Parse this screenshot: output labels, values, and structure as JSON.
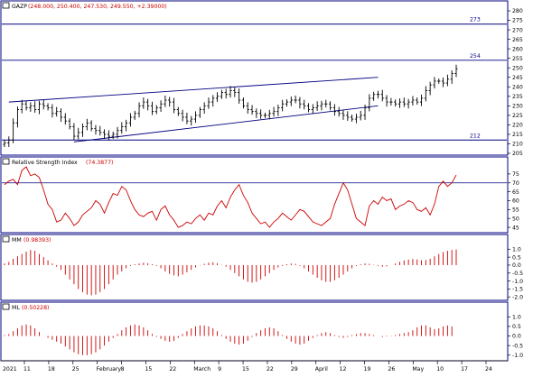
{
  "panels": {
    "price": {
      "ticker": "GAZP",
      "ohlc_readout": "(248.000, 250.400, 247.530, 249.550, +2.39000)",
      "levels": [
        {
          "value": 273,
          "label": "273"
        },
        {
          "value": 254,
          "label": "254"
        },
        {
          "value": 212,
          "label": "212"
        }
      ]
    },
    "rsi": {
      "name": "Relative Strength Index",
      "readout": "(74.3877)",
      "level": 70
    },
    "mm": {
      "name": "MM",
      "readout": "(0.98393)"
    },
    "ml": {
      "name": "ML",
      "readout": "(0.50228)"
    }
  },
  "x_axis": {
    "labels": [
      "11",
      "18",
      "25",
      "February",
      "8",
      "15",
      "22",
      "March",
      "9",
      "15",
      "22",
      "29",
      "April",
      "12",
      "19",
      "26",
      "May",
      "10",
      "17",
      "24"
    ],
    "year_label": "2021"
  },
  "colors": {
    "frame": "#000080",
    "price_level": "#000080",
    "rsi_line": "#cc0000",
    "hist": "#cc0000",
    "bar": "#000000",
    "text_accent": "#cc0000"
  },
  "chart_data": [
    {
      "type": "ohlc",
      "title": "GAZP",
      "ylim": [
        205,
        280
      ],
      "yticks": [
        205,
        210,
        215,
        220,
        225,
        230,
        235,
        240,
        245,
        250,
        255,
        260,
        265,
        270,
        275,
        280
      ],
      "channel": [
        {
          "from": [
            1,
            232
          ],
          "to": [
            86,
            245
          ]
        },
        {
          "from": [
            16,
            211
          ],
          "to": [
            86,
            230
          ]
        }
      ],
      "close": [
        210.5,
        212,
        221,
        228,
        231,
        229,
        230,
        228,
        231,
        230,
        229,
        226,
        227,
        224,
        222,
        219,
        214,
        216,
        219,
        221,
        218,
        217,
        216,
        215,
        214,
        215,
        217,
        219,
        221,
        224,
        226,
        230,
        232,
        230,
        227,
        229,
        231,
        233,
        232,
        228,
        226,
        224,
        222,
        223,
        225,
        228,
        230,
        232,
        234,
        235,
        237,
        236,
        238,
        237,
        233,
        230,
        228,
        227,
        226,
        225,
        225,
        226,
        227,
        229,
        231,
        232,
        233,
        233,
        231,
        230,
        228,
        229,
        230,
        231,
        231,
        229,
        227,
        226,
        225,
        224,
        223,
        224,
        225,
        229,
        234,
        236,
        236,
        234,
        232,
        232,
        231,
        232,
        231,
        232,
        233,
        232,
        234,
        238,
        241,
        243,
        243,
        242,
        244,
        247,
        249.5
      ]
    },
    {
      "type": "line",
      "title": "Relative Strength Index",
      "ylim": [
        43,
        79
      ],
      "yticks": [
        45,
        50,
        55,
        60,
        65,
        70,
        75
      ],
      "values": [
        69,
        71,
        72,
        69,
        77,
        79,
        74,
        75,
        73,
        66,
        58,
        55,
        48,
        49,
        53,
        50,
        46,
        48,
        52,
        54,
        56,
        60,
        58,
        53,
        59,
        64,
        63,
        68,
        66,
        60,
        55,
        52,
        51,
        53,
        54,
        49,
        55,
        57,
        52,
        49,
        45,
        46,
        48,
        47,
        50,
        52,
        49,
        53,
        52,
        57,
        60,
        56,
        62,
        66,
        69,
        63,
        59,
        53,
        50,
        47,
        48,
        45,
        48,
        50,
        53,
        51,
        49,
        52,
        55,
        54,
        51,
        48,
        47,
        46,
        48,
        50,
        58,
        64,
        70,
        66,
        58,
        50,
        48,
        46,
        57,
        60,
        58,
        62,
        60,
        61,
        55,
        57,
        58,
        60,
        59,
        55,
        54,
        56,
        52,
        58,
        68,
        71,
        68,
        70,
        74.4
      ]
    },
    {
      "type": "bar",
      "title": "MM",
      "ylim": [
        -2.1,
        1.3
      ],
      "yticks": [
        -2.0,
        -1.5,
        -1.0,
        -0.5,
        0.0,
        0.5,
        1.0
      ],
      "values": [
        0.1,
        0.2,
        0.4,
        0.55,
        0.7,
        0.85,
        0.95,
        0.9,
        0.7,
        0.5,
        0.3,
        0.1,
        -0.1,
        -0.3,
        -0.6,
        -0.9,
        -1.2,
        -1.5,
        -1.7,
        -1.85,
        -1.9,
        -1.85,
        -1.7,
        -1.5,
        -1.2,
        -0.9,
        -0.6,
        -0.4,
        -0.2,
        -0.05,
        0.05,
        0.1,
        0.15,
        0.12,
        0.05,
        -0.05,
        -0.2,
        -0.4,
        -0.55,
        -0.65,
        -0.7,
        -0.6,
        -0.45,
        -0.3,
        -0.15,
        -0.02,
        0.08,
        0.15,
        0.18,
        0.12,
        0.02,
        -0.1,
        -0.3,
        -0.5,
        -0.7,
        -0.9,
        -1.05,
        -1.1,
        -1.05,
        -0.9,
        -0.7,
        -0.5,
        -0.3,
        -0.15,
        -0.05,
        0.05,
        0.1,
        0.08,
        -0.05,
        -0.2,
        -0.4,
        -0.6,
        -0.8,
        -0.95,
        -1.05,
        -1.05,
        -0.95,
        -0.8,
        -0.6,
        -0.4,
        -0.2,
        -0.05,
        0.05,
        0.1,
        0.08,
        0.02,
        -0.05,
        -0.1,
        -0.08,
        0.0,
        0.1,
        0.2,
        0.3,
        0.35,
        0.38,
        0.36,
        0.3,
        0.32,
        0.4,
        0.55,
        0.7,
        0.82,
        0.9,
        0.95,
        0.98
      ]
    },
    {
      "type": "bar",
      "title": "ML",
      "ylim": [
        -1.2,
        1.25
      ],
      "yticks": [
        -1.0,
        -0.5,
        0.0,
        0.5,
        1.0
      ],
      "values": [
        0.05,
        0.1,
        0.25,
        0.4,
        0.55,
        0.6,
        0.55,
        0.4,
        0.2,
        0.0,
        -0.1,
        -0.2,
        -0.3,
        -0.4,
        -0.55,
        -0.7,
        -0.85,
        -0.95,
        -1.0,
        -1.0,
        -0.95,
        -0.85,
        -0.7,
        -0.5,
        -0.3,
        -0.1,
        0.1,
        0.3,
        0.45,
        0.55,
        0.6,
        0.55,
        0.45,
        0.3,
        0.1,
        -0.05,
        -0.15,
        -0.25,
        -0.3,
        -0.25,
        -0.1,
        0.1,
        0.25,
        0.4,
        0.5,
        0.55,
        0.55,
        0.5,
        0.4,
        0.25,
        0.05,
        -0.15,
        -0.3,
        -0.4,
        -0.45,
        -0.4,
        -0.25,
        -0.05,
        0.15,
        0.3,
        0.4,
        0.45,
        0.4,
        0.25,
        0.05,
        -0.15,
        -0.3,
        -0.4,
        -0.45,
        -0.4,
        -0.25,
        -0.1,
        0.05,
        0.15,
        0.2,
        0.15,
        0.05,
        -0.05,
        -0.1,
        -0.05,
        0.05,
        0.1,
        0.15,
        0.15,
        0.1,
        0.05,
        0.0,
        -0.05,
        -0.03,
        0.02,
        0.05,
        0.1,
        0.15,
        0.2,
        0.3,
        0.45,
        0.55,
        0.55,
        0.45,
        0.35,
        0.4,
        0.5,
        0.55,
        0.5
      ]
    }
  ]
}
